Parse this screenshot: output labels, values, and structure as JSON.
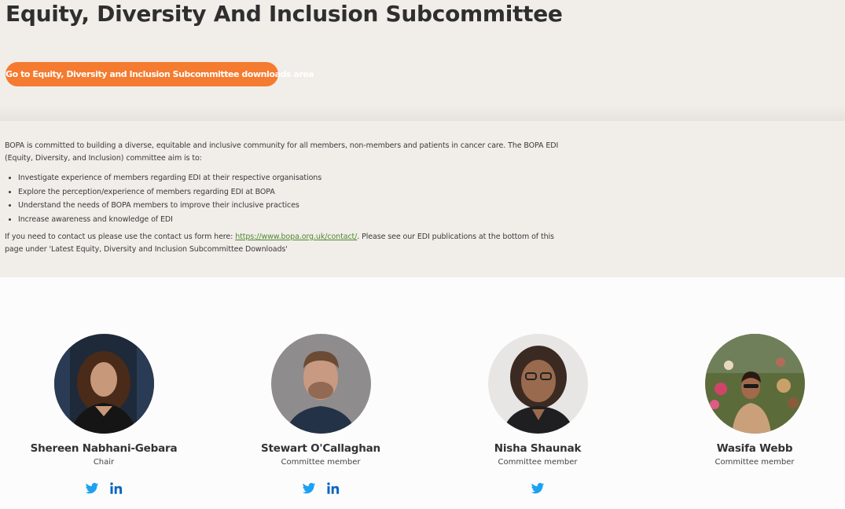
{
  "page": {
    "title": "Equity, Diversity And Inclusion Subcommittee",
    "downloads_button": "Go to Equity, Diversity and Inclusion Subcommittee downloads area"
  },
  "intro": {
    "paragraph": "BOPA is committed to building a diverse, equitable and inclusive community for all members, non-members and patients in cancer care. The BOPA EDI (Equity, Diversity, and Inclusion) committee aim is to:",
    "aims": [
      "Investigate experience of members regarding EDI at their respective organisations",
      "Explore the perception/experience of members regarding EDI at BOPA",
      "Understand the needs of BOPA members to improve their inclusive practices",
      "Increase awareness and knowledge of EDI"
    ],
    "contact_prefix": "If you need to contact us please use the contact us form here: ",
    "contact_link": "https://www.bopa.org.uk/contact/",
    "contact_suffix": ".  Please see our EDI publications at the bottom of this page under 'Latest Equity, Diversity and Inclusion Subcommittee Downloads'"
  },
  "members": [
    {
      "name": "Shereen Nabhani-Gebara",
      "role": "Chair",
      "socials": [
        "twitter-icon",
        "linkedin-icon"
      ]
    },
    {
      "name": "Stewart O'Callaghan",
      "role": "Committee member",
      "socials": [
        "twitter-icon",
        "linkedin-icon"
      ]
    },
    {
      "name": "Nisha Shaunak",
      "role": "Committee member",
      "socials": [
        "twitter-icon"
      ]
    },
    {
      "name": "Wasifa Webb",
      "role": "Committee member",
      "socials": []
    }
  ],
  "colors": {
    "accent": "#f47b2f",
    "link": "#4e8a2f",
    "twitter": "#1da1f2",
    "linkedin": "#0a66c2",
    "section_bg": "#f1ede9"
  }
}
